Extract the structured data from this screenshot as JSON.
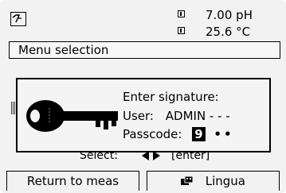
{
  "status": {
    "readings": [
      {
        "value": "7.00 pH"
      },
      {
        "value": "25.6 °C"
      }
    ]
  },
  "menu": {
    "title": "Menu selection"
  },
  "background": {
    "select_label": "Select:",
    "enter_label": "[enter]"
  },
  "dialog": {
    "title": "Enter signature:",
    "user_label": "User:",
    "user_value": "ADMIN - - -",
    "passcode_label": "Passcode:",
    "passcode_digit": "9",
    "passcode_mask": "••"
  },
  "softkeys": {
    "left": "Return to meas",
    "right": "Lingua"
  },
  "icons": {
    "mode": "measure-mode-icon",
    "channel": "sensor-channel-icon",
    "key": "key-icon",
    "language": "language-icon"
  }
}
